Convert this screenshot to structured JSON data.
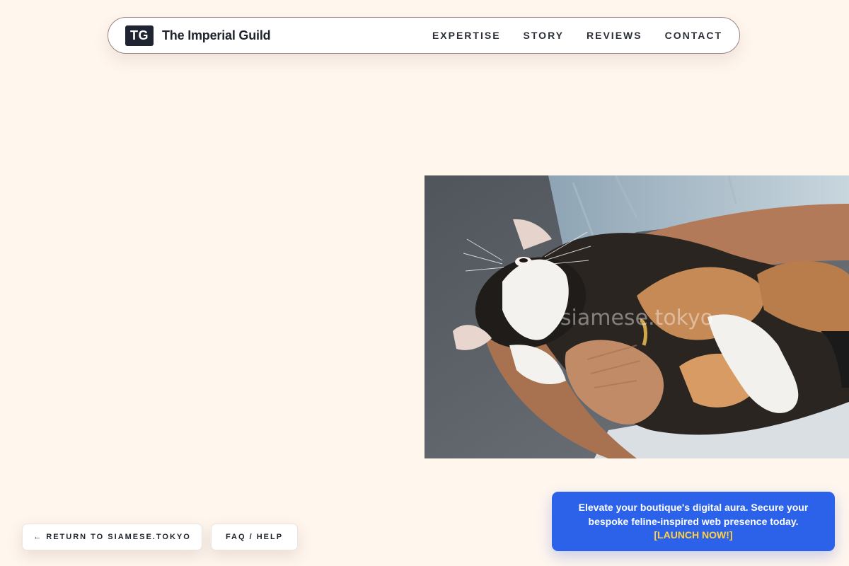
{
  "nav": {
    "logo_initials": "TG",
    "brand": "The Imperial Guild",
    "links": [
      "EXPERTISE",
      "STORY",
      "REVIEWS",
      "CONTACT"
    ]
  },
  "hero": {
    "watermark": "siamese.tokyo"
  },
  "footer_buttons": {
    "return_label": "← RETURN TO SIAMESE.TOKYO",
    "faq_label": "FAQ / HELP"
  },
  "promo": {
    "text": "Elevate your boutique's digital aura. Secure your bespoke feline-inspired web presence today.",
    "cta": "[LAUNCH NOW!]"
  },
  "colors": {
    "background": "#fff6ee",
    "logo_badge": "#1f2433",
    "promo_bg": "#2c62ea",
    "promo_cta": "#ffd23f"
  }
}
